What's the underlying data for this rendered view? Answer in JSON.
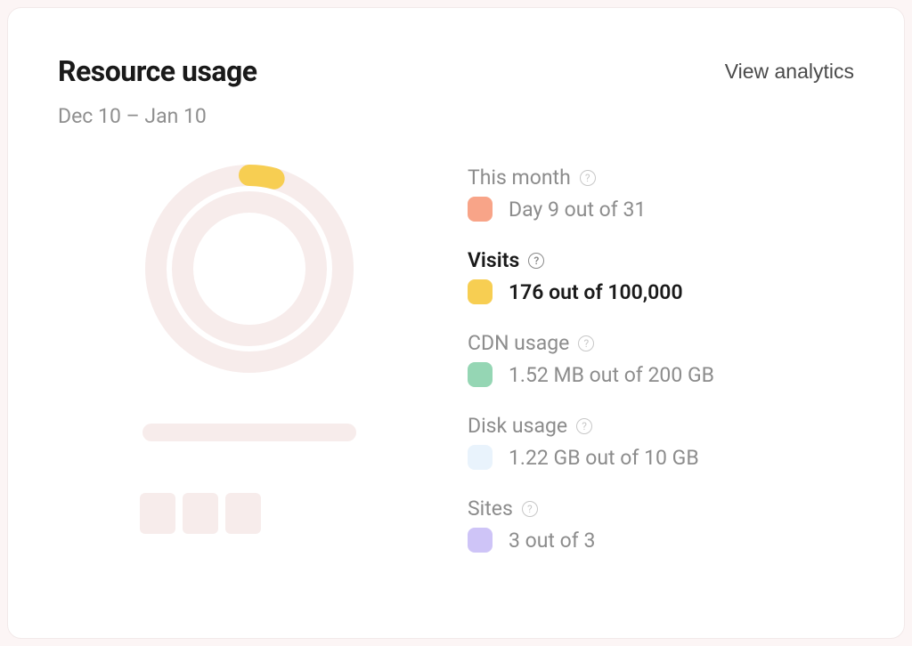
{
  "header": {
    "title": "Resource usage",
    "view_analytics_label": "View analytics",
    "date_range": "Dec 10 – Jan 10"
  },
  "metrics": {
    "month": {
      "label": "This month",
      "value": "Day 9 out of 31",
      "swatch_color": "#f8a488",
      "fraction": 0.29
    },
    "visits": {
      "label": "Visits",
      "value": "176 out of 100,000",
      "swatch_color": "#f7ce52",
      "fraction": 0.00176
    },
    "cdn": {
      "label": "CDN usage",
      "value": "1.52 MB out of 200 GB",
      "swatch_color": "#95d6b4",
      "fraction": 7.6e-06
    },
    "disk": {
      "label": "Disk usage",
      "value": "1.22 GB out of 10 GB",
      "swatch_color": "#e9f3fc",
      "fraction": 0.122
    },
    "sites": {
      "label": "Sites",
      "value": "3 out of 3",
      "swatch_color": "#cec4f7",
      "fraction": 1.0
    }
  },
  "chart_data": {
    "type": "other",
    "title": "Resource usage radial",
    "series": [
      {
        "name": "Visits",
        "value": 176,
        "max": 100000,
        "fraction": 0.00176,
        "color": "#f7ce52",
        "ring": "outer"
      }
    ],
    "note": "Inner radial tracks shown as faint placeholders; only Visits highlighted"
  }
}
